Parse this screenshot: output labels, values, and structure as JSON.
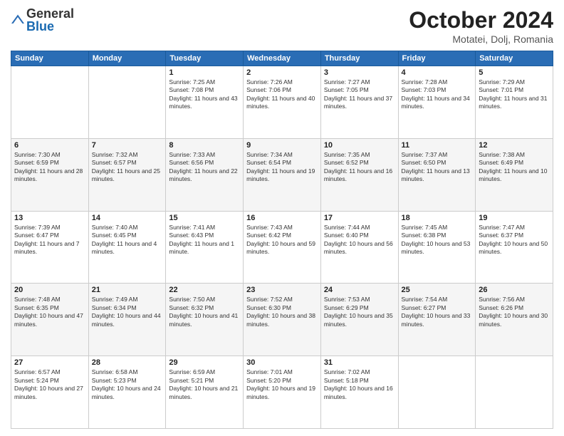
{
  "header": {
    "logo": {
      "general": "General",
      "blue": "Blue"
    },
    "title": "October 2024",
    "location": "Motatei, Dolj, Romania"
  },
  "weekdays": [
    "Sunday",
    "Monday",
    "Tuesday",
    "Wednesday",
    "Thursday",
    "Friday",
    "Saturday"
  ],
  "weeks": [
    [
      {
        "day": null
      },
      {
        "day": null
      },
      {
        "day": 1,
        "sunrise": "7:25 AM",
        "sunset": "7:08 PM",
        "daylight": "11 hours and 43 minutes."
      },
      {
        "day": 2,
        "sunrise": "7:26 AM",
        "sunset": "7:06 PM",
        "daylight": "11 hours and 40 minutes."
      },
      {
        "day": 3,
        "sunrise": "7:27 AM",
        "sunset": "7:05 PM",
        "daylight": "11 hours and 37 minutes."
      },
      {
        "day": 4,
        "sunrise": "7:28 AM",
        "sunset": "7:03 PM",
        "daylight": "11 hours and 34 minutes."
      },
      {
        "day": 5,
        "sunrise": "7:29 AM",
        "sunset": "7:01 PM",
        "daylight": "11 hours and 31 minutes."
      }
    ],
    [
      {
        "day": 6,
        "sunrise": "7:30 AM",
        "sunset": "6:59 PM",
        "daylight": "11 hours and 28 minutes."
      },
      {
        "day": 7,
        "sunrise": "7:32 AM",
        "sunset": "6:57 PM",
        "daylight": "11 hours and 25 minutes."
      },
      {
        "day": 8,
        "sunrise": "7:33 AM",
        "sunset": "6:56 PM",
        "daylight": "11 hours and 22 minutes."
      },
      {
        "day": 9,
        "sunrise": "7:34 AM",
        "sunset": "6:54 PM",
        "daylight": "11 hours and 19 minutes."
      },
      {
        "day": 10,
        "sunrise": "7:35 AM",
        "sunset": "6:52 PM",
        "daylight": "11 hours and 16 minutes."
      },
      {
        "day": 11,
        "sunrise": "7:37 AM",
        "sunset": "6:50 PM",
        "daylight": "11 hours and 13 minutes."
      },
      {
        "day": 12,
        "sunrise": "7:38 AM",
        "sunset": "6:49 PM",
        "daylight": "11 hours and 10 minutes."
      }
    ],
    [
      {
        "day": 13,
        "sunrise": "7:39 AM",
        "sunset": "6:47 PM",
        "daylight": "11 hours and 7 minutes."
      },
      {
        "day": 14,
        "sunrise": "7:40 AM",
        "sunset": "6:45 PM",
        "daylight": "11 hours and 4 minutes."
      },
      {
        "day": 15,
        "sunrise": "7:41 AM",
        "sunset": "6:43 PM",
        "daylight": "11 hours and 1 minute."
      },
      {
        "day": 16,
        "sunrise": "7:43 AM",
        "sunset": "6:42 PM",
        "daylight": "10 hours and 59 minutes."
      },
      {
        "day": 17,
        "sunrise": "7:44 AM",
        "sunset": "6:40 PM",
        "daylight": "10 hours and 56 minutes."
      },
      {
        "day": 18,
        "sunrise": "7:45 AM",
        "sunset": "6:38 PM",
        "daylight": "10 hours and 53 minutes."
      },
      {
        "day": 19,
        "sunrise": "7:47 AM",
        "sunset": "6:37 PM",
        "daylight": "10 hours and 50 minutes."
      }
    ],
    [
      {
        "day": 20,
        "sunrise": "7:48 AM",
        "sunset": "6:35 PM",
        "daylight": "10 hours and 47 minutes."
      },
      {
        "day": 21,
        "sunrise": "7:49 AM",
        "sunset": "6:34 PM",
        "daylight": "10 hours and 44 minutes."
      },
      {
        "day": 22,
        "sunrise": "7:50 AM",
        "sunset": "6:32 PM",
        "daylight": "10 hours and 41 minutes."
      },
      {
        "day": 23,
        "sunrise": "7:52 AM",
        "sunset": "6:30 PM",
        "daylight": "10 hours and 38 minutes."
      },
      {
        "day": 24,
        "sunrise": "7:53 AM",
        "sunset": "6:29 PM",
        "daylight": "10 hours and 35 minutes."
      },
      {
        "day": 25,
        "sunrise": "7:54 AM",
        "sunset": "6:27 PM",
        "daylight": "10 hours and 33 minutes."
      },
      {
        "day": 26,
        "sunrise": "7:56 AM",
        "sunset": "6:26 PM",
        "daylight": "10 hours and 30 minutes."
      }
    ],
    [
      {
        "day": 27,
        "sunrise": "6:57 AM",
        "sunset": "5:24 PM",
        "daylight": "10 hours and 27 minutes."
      },
      {
        "day": 28,
        "sunrise": "6:58 AM",
        "sunset": "5:23 PM",
        "daylight": "10 hours and 24 minutes."
      },
      {
        "day": 29,
        "sunrise": "6:59 AM",
        "sunset": "5:21 PM",
        "daylight": "10 hours and 21 minutes."
      },
      {
        "day": 30,
        "sunrise": "7:01 AM",
        "sunset": "5:20 PM",
        "daylight": "10 hours and 19 minutes."
      },
      {
        "day": 31,
        "sunrise": "7:02 AM",
        "sunset": "5:18 PM",
        "daylight": "10 hours and 16 minutes."
      },
      {
        "day": null
      },
      {
        "day": null
      }
    ]
  ]
}
